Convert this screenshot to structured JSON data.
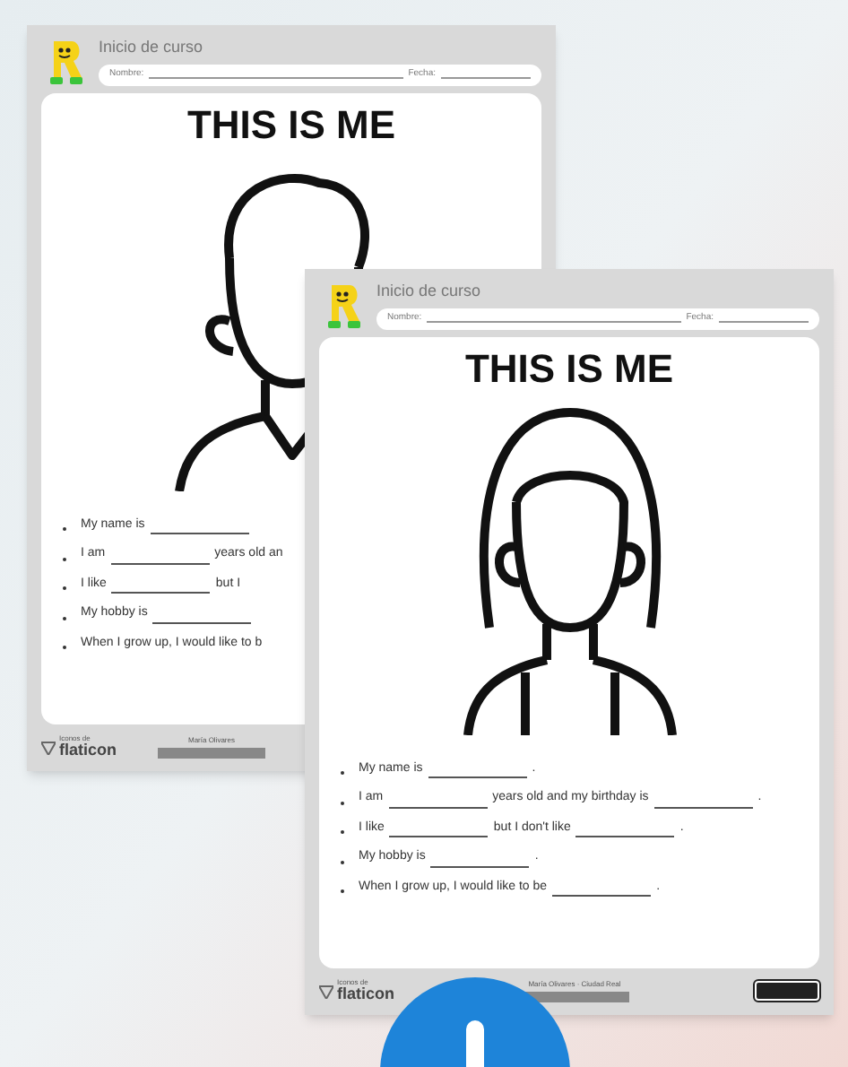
{
  "worksheets": [
    {
      "kind": "boy",
      "header_title": "Inicio de curso",
      "name_label": "Nombre:",
      "date_label": "Fecha:",
      "title": "THIS IS ME",
      "sentences": [
        [
          {
            "kind": "text",
            "text": "My name is"
          },
          {
            "kind": "blank"
          }
        ],
        [
          {
            "kind": "text",
            "text": "I am"
          },
          {
            "kind": "blank"
          },
          {
            "kind": "text",
            "text": "years old an"
          }
        ],
        [
          {
            "kind": "text",
            "text": "I like"
          },
          {
            "kind": "blank"
          },
          {
            "kind": "text",
            "text": "but I"
          }
        ],
        [
          {
            "kind": "text",
            "text": "My hobby is"
          },
          {
            "kind": "blank"
          }
        ],
        [
          {
            "kind": "text",
            "text": "When I grow up, I would like to b"
          }
        ]
      ],
      "credit_small": "Iconos de",
      "credit_brand": "flaticon",
      "author": "María Olivares"
    },
    {
      "kind": "girl",
      "header_title": "Inicio de curso",
      "name_label": "Nombre:",
      "date_label": "Fecha:",
      "title": "THIS IS ME",
      "sentences": [
        [
          {
            "kind": "text",
            "text": "My name is"
          },
          {
            "kind": "blank"
          },
          {
            "kind": "text",
            "text": "."
          }
        ],
        [
          {
            "kind": "text",
            "text": "I am"
          },
          {
            "kind": "blank"
          },
          {
            "kind": "text",
            "text": "years old and my birthday is"
          },
          {
            "kind": "blank"
          },
          {
            "kind": "text",
            "text": "."
          }
        ],
        [
          {
            "kind": "text",
            "text": "I like"
          },
          {
            "kind": "blank"
          },
          {
            "kind": "text",
            "text": "but I don't like"
          },
          {
            "kind": "blank"
          },
          {
            "kind": "text",
            "text": "."
          }
        ],
        [
          {
            "kind": "text",
            "text": "My hobby is"
          },
          {
            "kind": "blank"
          },
          {
            "kind": "text",
            "text": "."
          }
        ],
        [
          {
            "kind": "text",
            "text": "When I grow up, I would like to be"
          },
          {
            "kind": "blank"
          },
          {
            "kind": "text",
            "text": "."
          }
        ]
      ],
      "credit_small": "Iconos de",
      "credit_brand": "flaticon",
      "author": "María Olivares · Ciudad Real"
    }
  ]
}
